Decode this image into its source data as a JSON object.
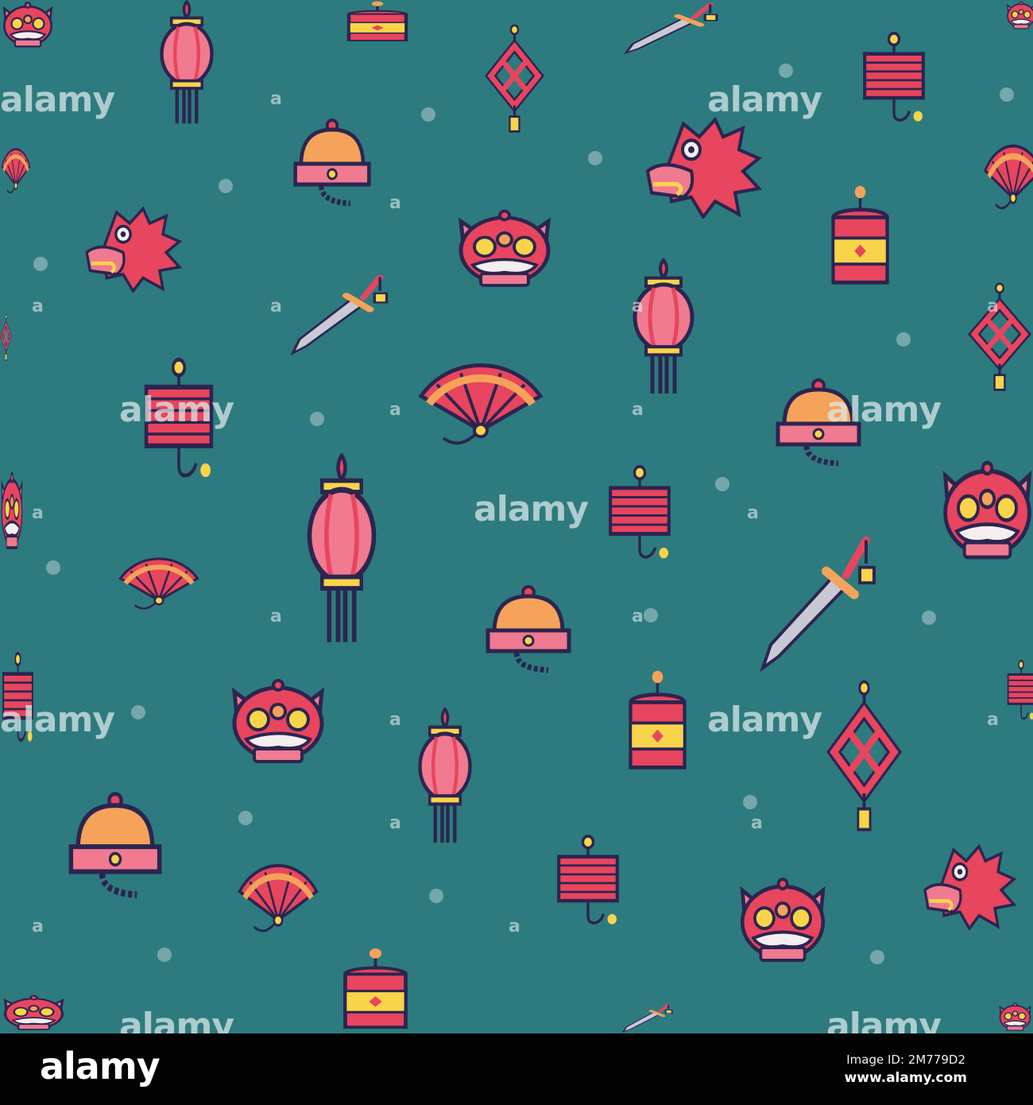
{
  "watermark": {
    "text": "alamy",
    "small": "a"
  },
  "footer": {
    "logo": "alamy",
    "image_id": "Image ID: 2M779D2",
    "url": "www.alamy.com"
  },
  "colors": {
    "background": "#2d7b7f",
    "red": "#e8455e",
    "pink": "#f07a8f",
    "orange": "#f5a25a",
    "yellow": "#f8d44a",
    "outline": "#2b2550"
  }
}
